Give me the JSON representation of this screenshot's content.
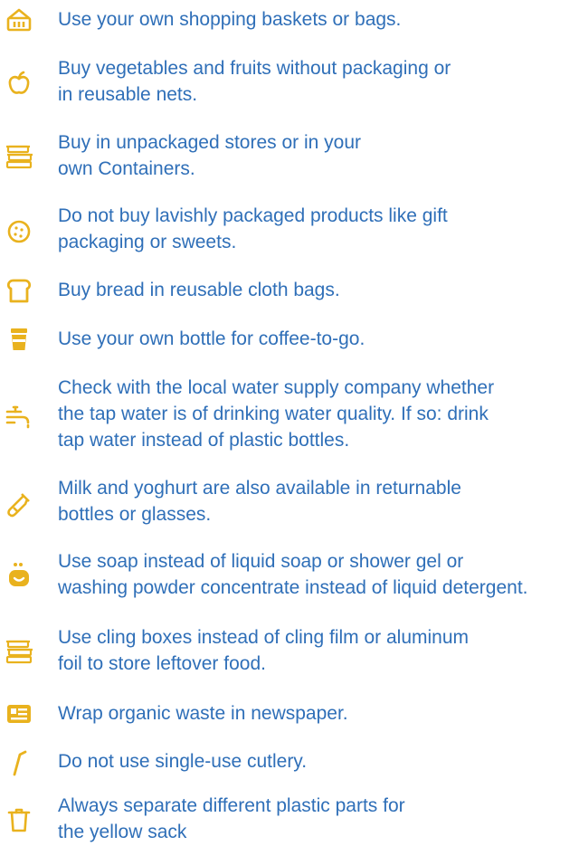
{
  "colors": {
    "text": "#2f6fb8",
    "icon": "#e9b21e"
  },
  "tips": [
    {
      "icon": "basket-icon",
      "text": "Use your own shopping baskets or bags."
    },
    {
      "icon": "apple-icon",
      "text": "Buy vegetables and fruits without packaging or\nin reusable nets."
    },
    {
      "icon": "containers-icon",
      "text": "Buy in unpackaged stores or in your\nown Containers."
    },
    {
      "icon": "cookie-icon",
      "text": "Do not buy lavishly packaged products like gift\npackaging or sweets."
    },
    {
      "icon": "bread-icon",
      "text": "Buy bread in reusable cloth bags."
    },
    {
      "icon": "coffee-cup-icon",
      "text": "Use your own bottle for coffee-to-go."
    },
    {
      "icon": "tap-icon",
      "text": "Check with the local water supply company whether\nthe tap water is of drinking water quality. If so: drink\ntap water instead of plastic bottles."
    },
    {
      "icon": "milk-bottle-icon",
      "text": "Milk and yoghurt are also available in returnable\nbottles or glasses."
    },
    {
      "icon": "soap-icon",
      "text": "Use soap instead of liquid soap or shower gel or\nwashing powder concentrate instead of liquid detergent."
    },
    {
      "icon": "cling-boxes-icon",
      "text": "Use cling boxes instead of cling film or aluminum\nfoil to store leftover food."
    },
    {
      "icon": "newspaper-icon",
      "text": "Wrap organic waste in newspaper."
    },
    {
      "icon": "straw-icon",
      "text": "Do not use single-use cutlery."
    },
    {
      "icon": "trash-bin-icon",
      "text": "Always separate different plastic parts for\nthe yellow sack"
    }
  ]
}
